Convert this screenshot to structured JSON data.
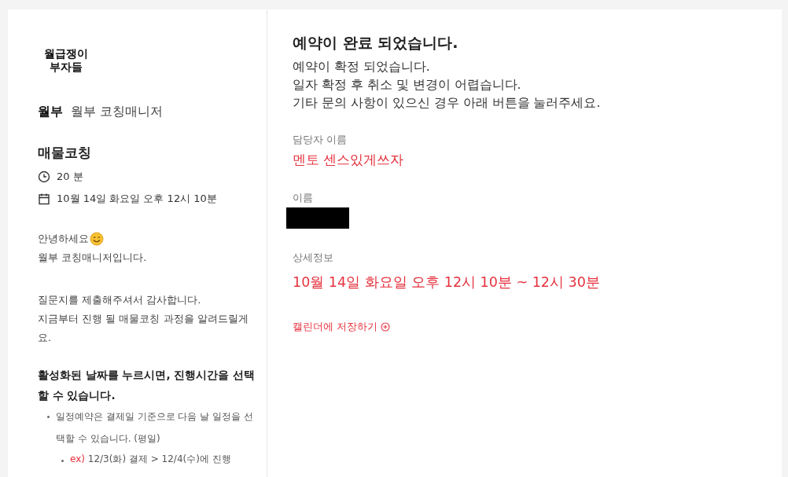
{
  "sidebar": {
    "logo": [
      "월급쟁이",
      "부자들"
    ],
    "host_badge": "월부",
    "host_name": "월부 코칭매니저",
    "event_title": "매물코칭",
    "duration": "20 분",
    "date": "10월 14일 화요일 오후 12시 10분",
    "greeting": [
      "안녕하세요",
      "월부 코칭매니저입니다."
    ],
    "intro": [
      "질문지를 제출해주셔서 감사합니다.",
      "지금부터 진행 될 매물코칭 과정을 알려드릴게요."
    ],
    "notice": "활성화된 날짜를 누르시면, 진행시간을 선택할 수 있습니다.",
    "bullets": [
      {
        "text": "일정예약은 결제일 기준으로 다음 날 일정을 선택할 수 있습니다. (평일)",
        "children": [
          {
            "prefix": "ex)",
            "text": "12/3(화) 결제 > 12/4(수)에 진행"
          }
        ]
      }
    ]
  },
  "main": {
    "title": "예약이 완료 되었습니다.",
    "messages": [
      "예약이 확정 되었습니다.",
      "일자 확정 후 취소 및 변경이 어렵습니다.",
      "기타 문의 사항이 있으신 경우 아래 버튼을 눌러주세요."
    ],
    "host_label": "담당자 이름",
    "host_value": "멘토 센스있게쓰자",
    "name_label": "이름",
    "name_redacted": true,
    "detail_label": "상세정보",
    "detail_value": "10월 14일 화요일 오후 12시 10분 ~ 12시 30분",
    "calendar_link": "캘린더에 저장하기"
  }
}
